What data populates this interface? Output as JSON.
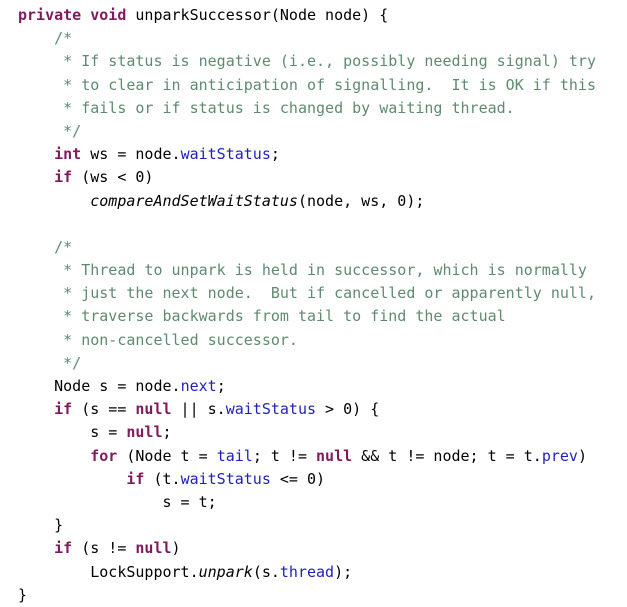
{
  "editor": {
    "language": "java",
    "background_color": "#ffffff",
    "font_size_px": 15,
    "line_height_px": 23.2,
    "colors": {
      "plain": "#000000",
      "keyword": "#7f1a5e",
      "comment": "#5f8a70",
      "field": "#1f1fbb",
      "method_italic": "#000000"
    }
  },
  "code": {
    "full_text": "private void unparkSuccessor(Node node) {\n    /*\n     * If status is negative (i.e., possibly needing signal) try\n     * to clear in anticipation of signalling.  It is OK if this\n     * fails or if status is changed by waiting thread.\n     */\n    int ws = node.waitStatus;\n    if (ws < 0)\n        compareAndSetWaitStatus(node, ws, 0);\n\n    /*\n     * Thread to unpark is held in successor, which is normally\n     * just the next node.  But if cancelled or apparently null,\n     * traverse backwards from tail to find the actual\n     * non-cancelled successor.\n     */\n    Node s = node.next;\n    if (s == null || s.waitStatus > 0) {\n        s = null;\n        for (Node t = tail; t != null && t != node; t = t.prev)\n            if (t.waitStatus <= 0)\n                s = t;\n    }\n    if (s != null)\n        LockSupport.unpark(s.thread);\n}",
    "lines": [
      {
        "n": 1,
        "tokens": [
          {
            "t": "private",
            "c": "keyword"
          },
          {
            "t": " ",
            "c": "plain"
          },
          {
            "t": "void",
            "c": "keyword"
          },
          {
            "t": " unparkSuccessor(Node node) {",
            "c": "plain"
          }
        ]
      },
      {
        "n": 2,
        "tokens": [
          {
            "t": "    /*",
            "c": "comment"
          }
        ]
      },
      {
        "n": 3,
        "tokens": [
          {
            "t": "     * If status is negative (i.e., possibly needing signal) try",
            "c": "comment"
          }
        ]
      },
      {
        "n": 4,
        "tokens": [
          {
            "t": "     * to clear in anticipation of signalling.  It is OK if this",
            "c": "comment"
          }
        ]
      },
      {
        "n": 5,
        "tokens": [
          {
            "t": "     * fails or if status is changed by waiting thread.",
            "c": "comment"
          }
        ]
      },
      {
        "n": 6,
        "tokens": [
          {
            "t": "     */",
            "c": "comment"
          }
        ]
      },
      {
        "n": 7,
        "tokens": [
          {
            "t": "    ",
            "c": "plain"
          },
          {
            "t": "int",
            "c": "keyword"
          },
          {
            "t": " ws = node.",
            "c": "plain"
          },
          {
            "t": "waitStatus",
            "c": "field"
          },
          {
            "t": ";",
            "c": "plain"
          }
        ]
      },
      {
        "n": 8,
        "tokens": [
          {
            "t": "    ",
            "c": "plain"
          },
          {
            "t": "if",
            "c": "keyword"
          },
          {
            "t": " (ws < 0)",
            "c": "plain"
          }
        ]
      },
      {
        "n": 9,
        "tokens": [
          {
            "t": "        ",
            "c": "plain"
          },
          {
            "t": "compareAndSetWaitStatus",
            "c": "method"
          },
          {
            "t": "(node, ws, 0);",
            "c": "plain"
          }
        ]
      },
      {
        "n": 10,
        "tokens": [
          {
            "t": "",
            "c": "plain"
          }
        ]
      },
      {
        "n": 11,
        "tokens": [
          {
            "t": "    /*",
            "c": "comment"
          }
        ]
      },
      {
        "n": 12,
        "tokens": [
          {
            "t": "     * Thread to unpark is held in successor, which is normally",
            "c": "comment"
          }
        ]
      },
      {
        "n": 13,
        "tokens": [
          {
            "t": "     * just the next node.  But if cancelled or apparently null,",
            "c": "comment"
          }
        ]
      },
      {
        "n": 14,
        "tokens": [
          {
            "t": "     * traverse backwards from tail to find the actual",
            "c": "comment"
          }
        ]
      },
      {
        "n": 15,
        "tokens": [
          {
            "t": "     * non-cancelled successor.",
            "c": "comment"
          }
        ]
      },
      {
        "n": 16,
        "tokens": [
          {
            "t": "     */",
            "c": "comment"
          }
        ]
      },
      {
        "n": 17,
        "tokens": [
          {
            "t": "    Node s = node.",
            "c": "plain"
          },
          {
            "t": "next",
            "c": "field"
          },
          {
            "t": ";",
            "c": "plain"
          }
        ]
      },
      {
        "n": 18,
        "tokens": [
          {
            "t": "    ",
            "c": "plain"
          },
          {
            "t": "if",
            "c": "keyword"
          },
          {
            "t": " (s == ",
            "c": "plain"
          },
          {
            "t": "null",
            "c": "keyword"
          },
          {
            "t": " || s.",
            "c": "plain"
          },
          {
            "t": "waitStatus",
            "c": "field"
          },
          {
            "t": " > 0) {",
            "c": "plain"
          }
        ]
      },
      {
        "n": 19,
        "tokens": [
          {
            "t": "        s = ",
            "c": "plain"
          },
          {
            "t": "null",
            "c": "keyword"
          },
          {
            "t": ";",
            "c": "plain"
          }
        ]
      },
      {
        "n": 20,
        "tokens": [
          {
            "t": "        ",
            "c": "plain"
          },
          {
            "t": "for",
            "c": "keyword"
          },
          {
            "t": " (Node t = ",
            "c": "plain"
          },
          {
            "t": "tail",
            "c": "field"
          },
          {
            "t": "; t != ",
            "c": "plain"
          },
          {
            "t": "null",
            "c": "keyword"
          },
          {
            "t": " && t != node; t = t.",
            "c": "plain"
          },
          {
            "t": "prev",
            "c": "field"
          },
          {
            "t": ")",
            "c": "plain"
          }
        ]
      },
      {
        "n": 21,
        "tokens": [
          {
            "t": "            ",
            "c": "plain"
          },
          {
            "t": "if",
            "c": "keyword"
          },
          {
            "t": " (t.",
            "c": "plain"
          },
          {
            "t": "waitStatus",
            "c": "field"
          },
          {
            "t": " <= 0)",
            "c": "plain"
          }
        ]
      },
      {
        "n": 22,
        "tokens": [
          {
            "t": "                s = t;",
            "c": "plain"
          }
        ]
      },
      {
        "n": 23,
        "tokens": [
          {
            "t": "    }",
            "c": "plain"
          }
        ]
      },
      {
        "n": 24,
        "tokens": [
          {
            "t": "    ",
            "c": "plain"
          },
          {
            "t": "if",
            "c": "keyword"
          },
          {
            "t": " (s != ",
            "c": "plain"
          },
          {
            "t": "null",
            "c": "keyword"
          },
          {
            "t": ")",
            "c": "plain"
          }
        ]
      },
      {
        "n": 25,
        "tokens": [
          {
            "t": "        LockSupport.",
            "c": "plain"
          },
          {
            "t": "unpark",
            "c": "method"
          },
          {
            "t": "(s.",
            "c": "plain"
          },
          {
            "t": "thread",
            "c": "field"
          },
          {
            "t": ");",
            "c": "plain"
          }
        ]
      },
      {
        "n": 26,
        "tokens": [
          {
            "t": "}",
            "c": "plain"
          }
        ]
      }
    ]
  }
}
